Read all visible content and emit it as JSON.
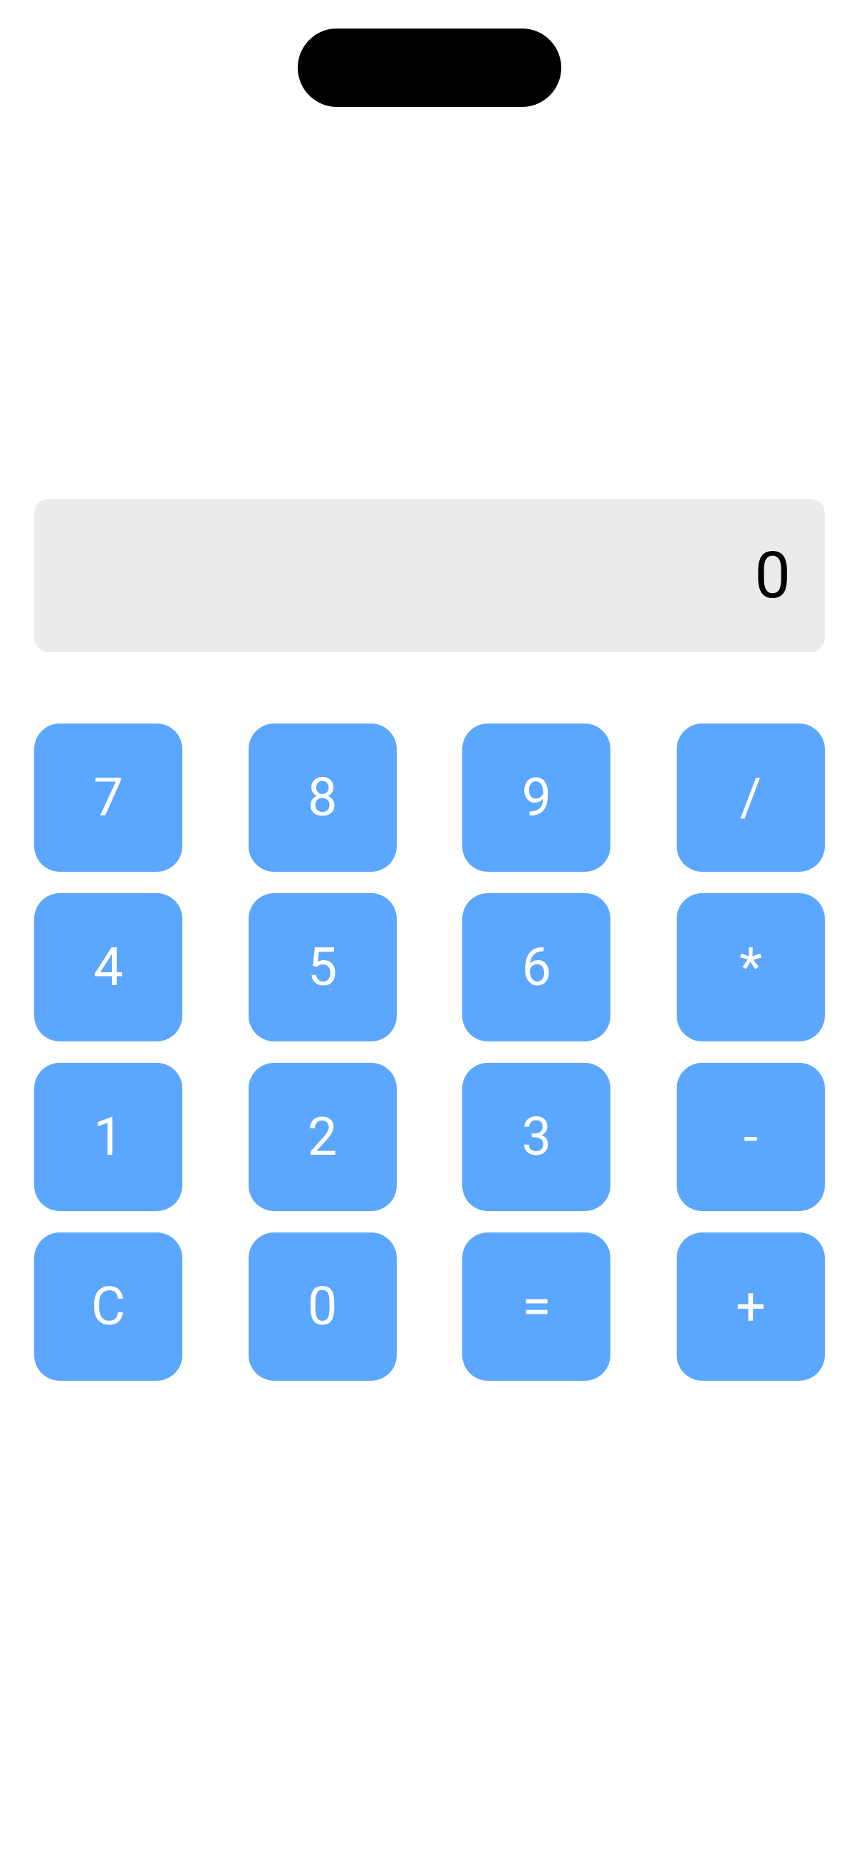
{
  "display": {
    "value": "0"
  },
  "keypad": {
    "rows": [
      [
        "7",
        "8",
        "9",
        "/"
      ],
      [
        "4",
        "5",
        "6",
        "*"
      ],
      [
        "1",
        "2",
        "3",
        "-"
      ],
      [
        "C",
        "0",
        "=",
        "+"
      ]
    ],
    "r0c0": "7",
    "r0c1": "8",
    "r0c2": "9",
    "r0c3": "/",
    "r1c0": "4",
    "r1c1": "5",
    "r1c2": "6",
    "r1c3": "*",
    "r2c0": "1",
    "r2c1": "2",
    "r2c2": "3",
    "r2c3": "-",
    "r3c0": "C",
    "r3c1": "0",
    "r3c2": "=",
    "r3c3": "+"
  },
  "colors": {
    "keyBackground": "#5ba6ff",
    "keyText": "#ffffff",
    "displayBackground": "#ebebeb",
    "displayText": "#000000"
  }
}
